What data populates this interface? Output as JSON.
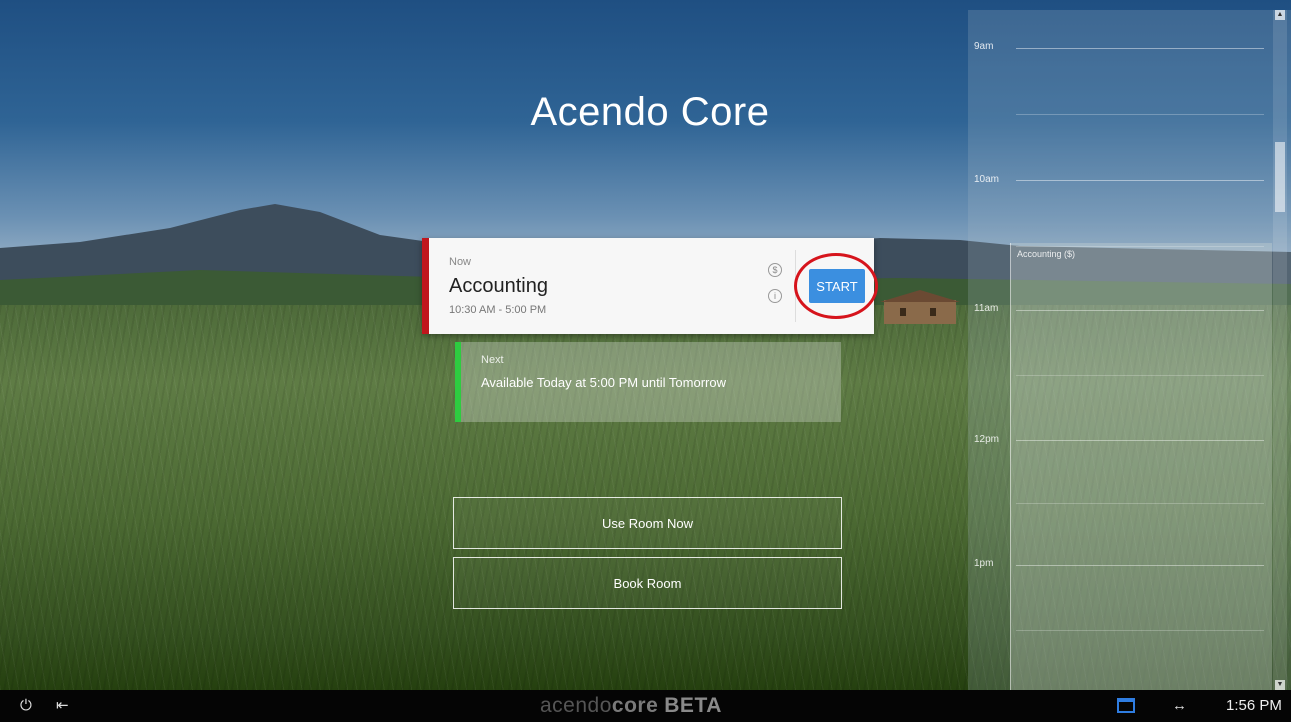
{
  "app": {
    "title": "Acendo Core"
  },
  "timeline": {
    "hours": [
      "9am",
      "10am",
      "11am",
      "12pm",
      "1pm"
    ],
    "event_label": "Accounting ($)"
  },
  "now_card": {
    "label": "Now",
    "title": "Accounting",
    "time": "10:30 AM - 5:00 PM",
    "start_label": "START",
    "money_icon_glyph": "$",
    "info_icon_glyph": "i",
    "accent_color": "#c0161d"
  },
  "next_card": {
    "label": "Next",
    "text": "Available Today at 5:00 PM until Tomorrow",
    "accent_color": "#2ecc40"
  },
  "actions": {
    "use_room": "Use Room Now",
    "book_room": "Book Room"
  },
  "taskbar": {
    "brand_part1": "acendo",
    "brand_part2": "core",
    "brand_part3": "BETA",
    "time": "1:56 PM",
    "power_glyph": "⏻",
    "logout_glyph": "⇤",
    "arrows_glyph": "↔"
  },
  "icons": [
    "power-icon",
    "logout-icon",
    "money-icon",
    "info-icon",
    "calendar-icon",
    "arrows-icon"
  ]
}
